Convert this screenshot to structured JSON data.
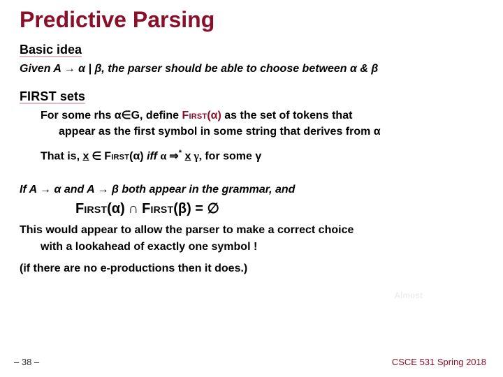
{
  "title": "Predictive Parsing",
  "subhead1": "Basic idea",
  "given_line": "Given A → α | β, the parser should be able to choose between α & β",
  "subhead2_prefix": "F",
  "subhead2_sc": "IRST",
  "subhead2_suffix": " sets",
  "def_part1": "For some rhs α∈G, define ",
  "def_first": "First",
  "def_arg": "(α)",
  "def_part2": " as the set of tokens that",
  "def_part3": "appear as the first symbol in some string that derives from α",
  "thatis_part1": "That is, ",
  "thatis_x": "x",
  "thatis_in": " ∈ ",
  "thatis_first": "First",
  "thatis_arg": "(α)",
  "thatis_iff": " iff ",
  "thatis_alpha": "α ",
  "thatis_der": "⇒",
  "thatis_star": "*",
  "thatis_space": " ",
  "thatis_x2": "x",
  "thatis_gamma": " γ,",
  "thatis_tail": "  for some γ",
  "if_line": "If A → α and A → β both appear in the grammar, and",
  "expr_first": "First",
  "expr_a": "(α)",
  "expr_cap": " ∩ ",
  "expr_b": "(β)",
  "expr_eq": " = ∅",
  "conc1": "This would appear to allow the parser to make a correct choice",
  "conc2": "with a lookahead of exactly one symbol !",
  "paren": "(if there are no e-productions then it does.)",
  "almost": "Almost",
  "page": "– 38 –",
  "course": "CSCE 531 Spring 2018"
}
